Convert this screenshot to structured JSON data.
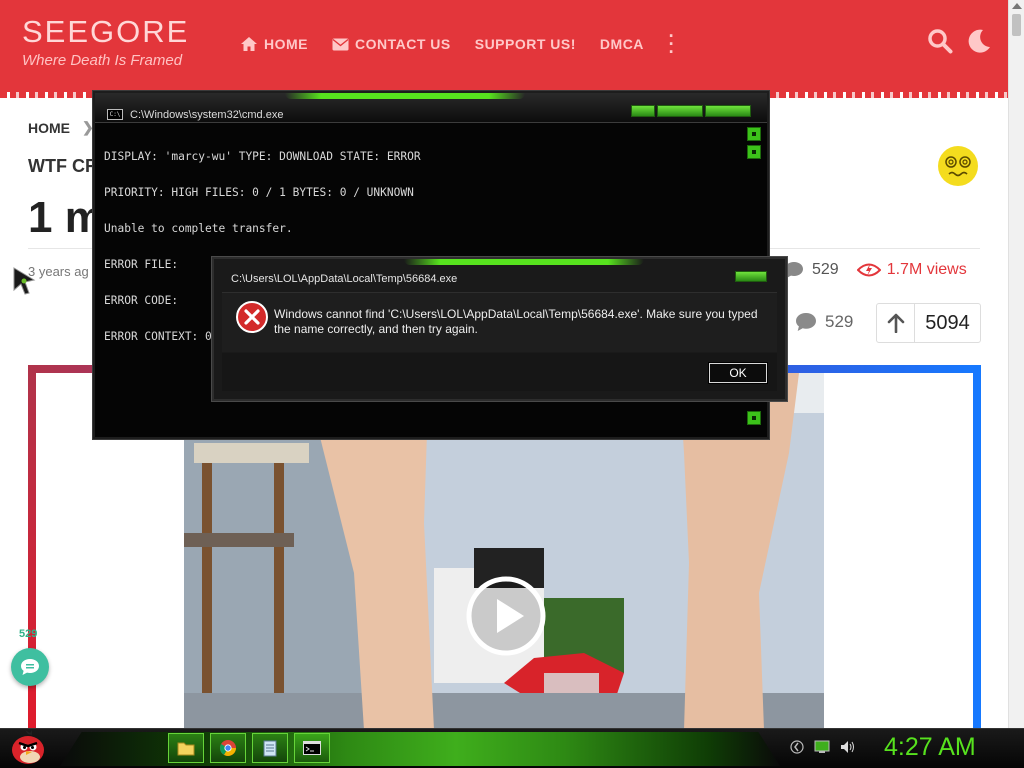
{
  "site": {
    "logo": "SEEGORE",
    "tagline": "Where Death Is Framed",
    "nav": [
      {
        "label": "HOME",
        "icon": "home-icon"
      },
      {
        "label": "CONTACT US",
        "icon": "envelope-icon"
      },
      {
        "label": "SUPPORT US!",
        "icon": ""
      },
      {
        "label": "DMCA",
        "icon": ""
      }
    ]
  },
  "page": {
    "breadcrumb_home": "HOME",
    "category": "WTF CR",
    "title": "1 m",
    "date": "3 years ag",
    "comments_count": "529",
    "views": "1.7M views",
    "comments_button_count": "529",
    "vote_count": "5094",
    "floating_count": "529"
  },
  "cmd": {
    "title": "C:\\Windows\\system32\\cmd.exe",
    "lines": [
      "DISPLAY: 'marcy-wu' TYPE: DOWNLOAD STATE: ERROR",
      "PRIORITY: HIGH FILES: 0 / 1 BYTES: 0 / UNKNOWN",
      "Unable to complete transfer.",
      "ERROR FILE:     https://tmpfiles.org/dl/354360/109.exe -> C:\\Users\\LOL\\AppData\\L",
      "ERROR CODE:     0x80190194 - HTTP status 404: The requested URL does not exist o",
      "ERROR CONTEXT: 0x00000005 - The error occurred while the remote file was being"
    ]
  },
  "error_dialog": {
    "title": "C:\\Users\\LOL\\AppData\\Local\\Temp\\56684.exe",
    "message": "Windows cannot find 'C:\\Users\\LOL\\AppData\\Local\\Temp\\56684.exe'. Make sure you typed the name correctly, and then try again.",
    "ok_label": "OK"
  },
  "taskbar": {
    "clock": "4:27 AM",
    "apps": [
      "file-explorer-icon",
      "chrome-icon",
      "notepad-icon",
      "cmd-icon"
    ]
  },
  "colors": {
    "header_red": "#e3363b",
    "accent_green": "#57e21e"
  }
}
